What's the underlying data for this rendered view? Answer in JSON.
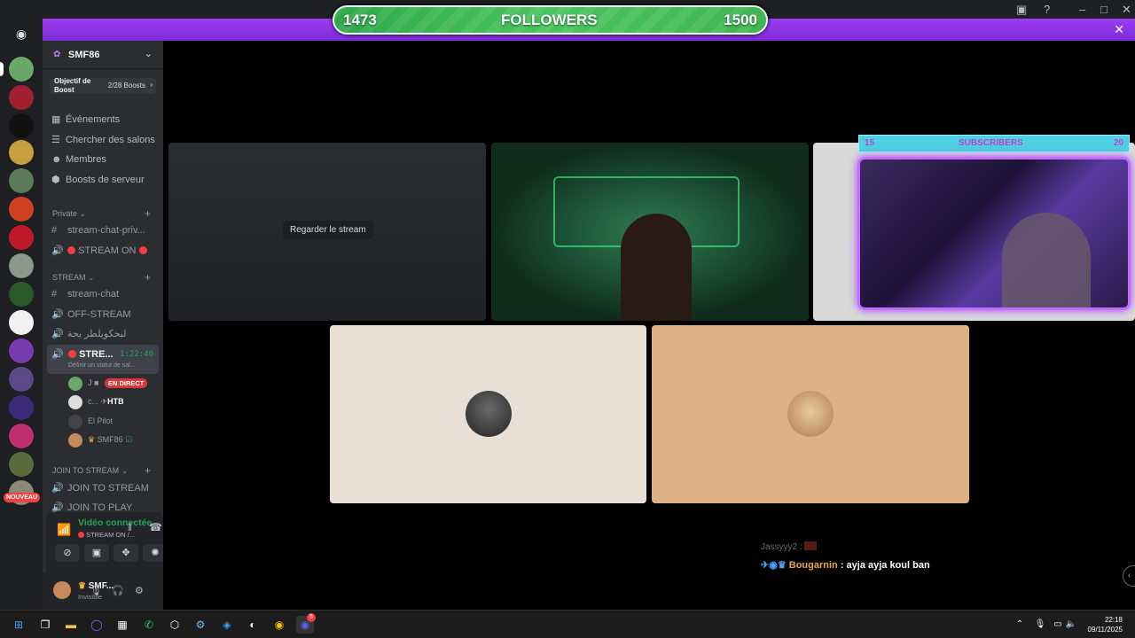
{
  "overlay": {
    "followers_current": "1473",
    "followers_label": "FOLLOWERS",
    "followers_goal": "1500",
    "followers_progress": 0.98,
    "subs_current": "15",
    "subs_label": "SUBSCRIBERS",
    "subs_goal": "20"
  },
  "server": {
    "name": "SMF86",
    "boost_label": "Objectif de Boost",
    "boost_value": "2/28 Boosts"
  },
  "menu": [
    {
      "label": "Événements",
      "icon": "calendar-icon"
    },
    {
      "label": "Chercher des salons",
      "icon": "list-icon"
    },
    {
      "label": "Membres",
      "icon": "members-icon"
    },
    {
      "label": "Boosts de serveur",
      "icon": "boost-icon"
    }
  ],
  "categories": {
    "private": "Private",
    "stream": "STREAM",
    "join": "JOIN TO STREAM"
  },
  "channels": {
    "private_text": "stream-chat-priv...",
    "private_voice": "STREAM ON",
    "stream_chat": "stream-chat",
    "off_stream": "OFF-STREAM",
    "arabic": "لبحكويلطر يحة",
    "active_name": "STRE...",
    "active_time": "1:22:40",
    "active_status": "Définir un statut de sal...",
    "join_stream": "JOIN TO STREAM",
    "join_play": "JOIN TO PLAY"
  },
  "voice_users": [
    {
      "name": "J",
      "badge": "EN DIRECT"
    },
    {
      "name": "c...",
      "badge": "HTB"
    },
    {
      "name": "El Pilot",
      "badge": ""
    },
    {
      "name": "SMF86",
      "badge": ""
    }
  ],
  "voice_panel": {
    "status": "Vidéo connectée",
    "channel": "STREAM ON /..."
  },
  "user_panel": {
    "name": "SMF...",
    "status": "Invisible"
  },
  "stream": {
    "watch_button": "Regarder le stream"
  },
  "chat": {
    "line1_user": "Jassyyy2 :",
    "line2_user": "Bougarnin",
    "line2_text": ": ayja ayja koul ban"
  },
  "notification_badge": "NOUVEAU",
  "taskbar": {
    "time": "22:18",
    "date": "09/11/2025",
    "discord_badge": "5"
  },
  "colors": {
    "discord_purple": "#8a2be2",
    "followers_green": "#4ac45e",
    "live_red": "#da373c",
    "connected_green": "#23a559"
  }
}
